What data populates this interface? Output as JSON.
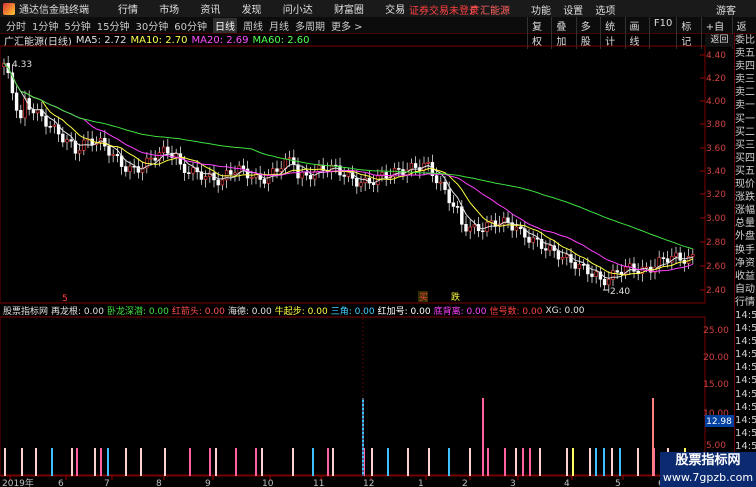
{
  "app": {
    "name": "通达信金融终端",
    "menu": [
      "行情",
      "市场",
      "资讯",
      "发现",
      "问小达",
      "财富圈",
      "交易"
    ],
    "login": "证券交易未登录",
    "broker": "广汇能源",
    "window_menu": [
      "功能",
      "设置",
      "选项"
    ],
    "guest": "游客"
  },
  "periods": [
    "分时",
    "1分钟",
    "5分钟",
    "15分钟",
    "30分钟",
    "60分钟",
    "日线",
    "周线",
    "月线",
    "多周期",
    "更多 >"
  ],
  "active_period": "日线",
  "rtools": [
    "复权",
    "叠加",
    "多股",
    "统计",
    "画线",
    "F10",
    "标记",
    "+自选",
    "返回"
  ],
  "info": {
    "stock": "广汇能源(日线)",
    "ma5": "MA5: 2.72",
    "ma10": "MA10: 2.70",
    "ma20": "MA20: 2.69",
    "ma60": "MA60: 2.60"
  },
  "sidebar_btn": "返回",
  "sidebar": [
    "委比",
    "卖五",
    "卖四",
    "卖三",
    "卖二",
    "卖一",
    "买一",
    "买二",
    "买三",
    "买四",
    "买五",
    "现价",
    "涨跌",
    "涨幅",
    "总量",
    "外盘",
    "换手",
    "净资",
    "收益",
    "自动",
    "行情",
    "14:50",
    "14:50",
    "14:50",
    "14:50",
    "14:50",
    "14:50",
    "14:50",
    "14:50",
    "14:50",
    "14:50",
    "14:50",
    "14:50"
  ],
  "indicator": {
    "name": "股票指标网",
    "items": [
      "再龙根: 0.00",
      "卧龙深潜: 0.00",
      "红箭头: 0.00",
      "海德: 0.00",
      "牛起步: 0.00",
      "三角: 0.00",
      "红加号: 0.00",
      "底背离: 0.00",
      "信号数: 0.00",
      "XG: 0.00"
    ],
    "colors": [
      "#e0e0e0",
      "#40e040",
      "#ff5050",
      "#e0e0e0",
      "#ffff40",
      "#40d0ff",
      "#ffffff",
      "#ff40ff",
      "#ff4040",
      "#e0e0e0"
    ]
  },
  "labels": {
    "high": "4.33",
    "low": "2.40",
    "sig1": "买",
    "sig2": "跌",
    "sig3": "5"
  },
  "yaxis": [
    "4.40",
    "4.20",
    "4.00",
    "3.80",
    "3.60",
    "3.40",
    "3.20",
    "3.00",
    "2.80",
    "2.60",
    "2.40"
  ],
  "yaxis2": [
    "25.00",
    "20.00",
    "15.00",
    "10.00",
    "5.00"
  ],
  "xaxis": [
    "2019年",
    "6",
    "7",
    "8",
    "9",
    "10",
    "11",
    "12",
    "1",
    "2",
    "3",
    "4",
    "5",
    "6"
  ],
  "highlight": "12.98",
  "watermark": {
    "line1": "股票指标网",
    "line2": "www.7gpzb.com"
  }
}
